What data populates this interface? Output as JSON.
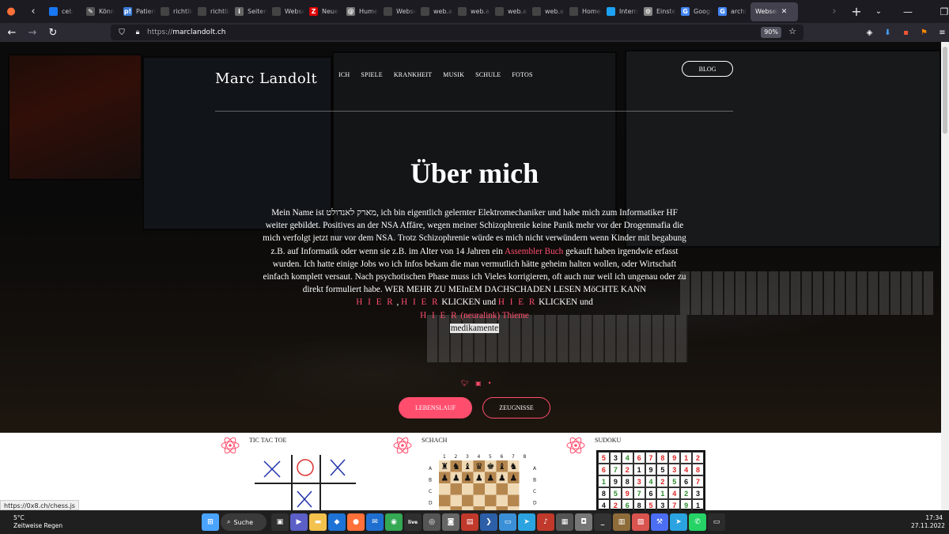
{
  "browser": {
    "tabs": [
      {
        "label": "ceb",
        "icon_color": "#1877f2",
        "icon": ""
      },
      {
        "label": "Könn",
        "icon_color": "#555",
        "icon": "✎"
      },
      {
        "label": "Patien",
        "icon_color": "#3a7bd5",
        "icon": "p!"
      },
      {
        "label": "richtlinien",
        "icon_color": "#444",
        "icon": ""
      },
      {
        "label": "richtlinien",
        "icon_color": "#444",
        "icon": ""
      },
      {
        "label": "Seiten",
        "icon_color": "#666",
        "icon": "i"
      },
      {
        "label": "Webseite",
        "icon_color": "#444",
        "icon": ""
      },
      {
        "label": "Neue",
        "icon_color": "#d00",
        "icon": "Z"
      },
      {
        "label": "Hume",
        "icon_color": "#777",
        "icon": "@"
      },
      {
        "label": "Webseite",
        "icon_color": "#444",
        "icon": ""
      },
      {
        "label": "web.archi",
        "icon_color": "#444",
        "icon": ""
      },
      {
        "label": "web.archi",
        "icon_color": "#444",
        "icon": ""
      },
      {
        "label": "web.archi",
        "icon_color": "#444",
        "icon": ""
      },
      {
        "label": "web.archi",
        "icon_color": "#444",
        "icon": ""
      },
      {
        "label": "Homepage",
        "icon_color": "#444",
        "icon": ""
      },
      {
        "label": "Intern",
        "icon_color": "#1da1f2",
        "icon": ""
      },
      {
        "label": "Einste",
        "icon_color": "#888",
        "icon": "⚙"
      },
      {
        "label": "Googl",
        "icon_color": "#4285f4",
        "icon": "G"
      },
      {
        "label": "archi",
        "icon_color": "#4285f4",
        "icon": "G"
      }
    ],
    "active_tab": {
      "label": "Websei",
      "close": "✕"
    },
    "url_scheme": "https://",
    "url_host": "marclandolt.ch",
    "zoom": "90%",
    "status_url": "https://0x8.ch/chess.js"
  },
  "site": {
    "logo": "Marc Landolt",
    "menu": [
      "ICH",
      "SPIELE",
      "KRANKHEIT",
      "MUSIK",
      "SCHULE",
      "FOTOS"
    ],
    "blog": "BLOG",
    "title": "Über mich",
    "para": {
      "t1": "Mein Name ist מארק לאנדולט, ich bin eigentlich gelernter Elektromechaniker und habe mich zum Informatiker HF weiter gebildet. Positives an der NSA Affäre, wegen meiner Schizophrenie keine Panik mehr vor der Drogenmafia die mich verfolgt jetzt nur vor dem NSA. Trotz Schizophrenie würde es mich nicht verwündern wenn Kinder mit begabung z.B. auf Informatik oder wenn sie z.B. im Alter von 14 Jahren ein ",
      "link1": "Assembler Buch",
      "t2": " gekauft haben irgendwie erfasst wurden. Ich hatte einige Jobs wo ich Infos bekam die man vermutlich hätte geheim halten wollen, oder Wirtschaft einfach komplett versaut. Nach psychotischen Phase muss ich Vieles korrigieren, oft auch nur weil ich ungenau oder zu direkt formuliert habe. WER MEHR ZU MEInEM DACHSCHADEN LESEN MöCHTE KANN",
      "hier1": "H I E R",
      "sep1": " , ",
      "hier2": "H I E R",
      "t3": " KLICKEN und ",
      "hier3": "H I E R",
      "t4": " KLICKEN und",
      "hier4": "H I E R",
      "neuralink": " (neuralink) Thieme",
      "medikamente": "medikamente"
    },
    "btn_cv": "LEBENSLAUF",
    "btn_zeugnisse": "ZEUGNISSE",
    "games": [
      {
        "title": "TIC TAC TOE"
      },
      {
        "title": "SCHACH"
      },
      {
        "title": "SUDOKU"
      }
    ],
    "chess_rows": [
      "A",
      "B",
      "C",
      "D"
    ],
    "chess_cols": [
      "1",
      "2",
      "3",
      "4",
      "5",
      "6",
      "7",
      "8"
    ],
    "sudoku": [
      [
        [
          "5",
          "r"
        ],
        [
          "3",
          "k"
        ],
        [
          "4",
          "g"
        ],
        [
          "6",
          "r"
        ],
        [
          "7",
          "r"
        ],
        [
          "8",
          "r"
        ],
        [
          "9",
          "r"
        ],
        [
          "1",
          "r"
        ],
        [
          "2",
          "r"
        ]
      ],
      [
        [
          "6",
          "r"
        ],
        [
          "7",
          "g"
        ],
        [
          "2",
          "r"
        ],
        [
          "1",
          "k"
        ],
        [
          "9",
          "k"
        ],
        [
          "5",
          "k"
        ],
        [
          "3",
          "r"
        ],
        [
          "4",
          "r"
        ],
        [
          "8",
          "r"
        ]
      ],
      [
        [
          "1",
          "g"
        ],
        [
          "9",
          "k"
        ],
        [
          "8",
          "k"
        ],
        [
          "3",
          "r"
        ],
        [
          "4",
          "g"
        ],
        [
          "2",
          "r"
        ],
        [
          "5",
          "g"
        ],
        [
          "6",
          "k"
        ],
        [
          "7",
          "r"
        ]
      ],
      [
        [
          "8",
          "k"
        ],
        [
          "5",
          "g"
        ],
        [
          "9",
          "r"
        ],
        [
          "7",
          "g"
        ],
        [
          "6",
          "k"
        ],
        [
          "1",
          "g"
        ],
        [
          "4",
          "r"
        ],
        [
          "2",
          "g"
        ],
        [
          "3",
          "k"
        ]
      ],
      [
        [
          "4",
          "k"
        ],
        [
          "2",
          "r"
        ],
        [
          "6",
          "g"
        ],
        [
          "8",
          "k"
        ],
        [
          "5",
          "r"
        ],
        [
          "3",
          "k"
        ],
        [
          "7",
          "r"
        ],
        [
          "9",
          "g"
        ],
        [
          "1",
          "k"
        ]
      ]
    ]
  },
  "taskbar": {
    "temp": "5°C",
    "weather": "Zeitweise Regen",
    "search": "Suche",
    "time": "17:34",
    "date": "27.11.2022",
    "icons": [
      {
        "name": "windows-start-icon",
        "color": "#4aa4ff",
        "glyph": "⊞"
      },
      {
        "name": "taskview-icon",
        "color": "#2f2f2f",
        "glyph": "▣"
      },
      {
        "name": "teams-icon",
        "color": "#5b5fc7",
        "glyph": "▶"
      },
      {
        "name": "explorer-icon",
        "color": "#f2c14e",
        "glyph": "▬"
      },
      {
        "name": "defender-icon",
        "color": "#1e73d6",
        "glyph": "◆"
      },
      {
        "name": "firefox-icon",
        "color": "#ff7139",
        "glyph": "●"
      },
      {
        "name": "thunderbird-icon",
        "color": "#1f6fd0",
        "glyph": "✉"
      },
      {
        "name": "chrome-icon",
        "color": "#34a853",
        "glyph": "◉"
      },
      {
        "name": "live-icon",
        "color": "#2f2f2f",
        "glyph": "live"
      },
      {
        "name": "disk-icon",
        "color": "#555",
        "glyph": "◎"
      },
      {
        "name": "camera-icon",
        "color": "#666",
        "glyph": "◙"
      },
      {
        "name": "app-red-icon",
        "color": "#c0392b",
        "glyph": "▤"
      },
      {
        "name": "powershell-icon",
        "color": "#2d5fa8",
        "glyph": "❯"
      },
      {
        "name": "remote-desktop-icon",
        "color": "#3a8fd6",
        "glyph": "▭"
      },
      {
        "name": "telegram-icon",
        "color": "#2aa3e0",
        "glyph": "➤"
      },
      {
        "name": "music-icon",
        "color": "#c0392b",
        "glyph": "♪"
      },
      {
        "name": "grid-app-icon",
        "color": "#555",
        "glyph": "▦"
      },
      {
        "name": "camera2-icon",
        "color": "#777",
        "glyph": "◘"
      },
      {
        "name": "terminal-icon",
        "color": "#333",
        "glyph": "_"
      },
      {
        "name": "library-icon",
        "color": "#8e6c3a",
        "glyph": "▥"
      },
      {
        "name": "pdf-icon",
        "color": "#d9534f",
        "glyph": "▧"
      },
      {
        "name": "tools-icon",
        "color": "#4c6ef5",
        "glyph": "⚒"
      },
      {
        "name": "telegram2-icon",
        "color": "#2aa3e0",
        "glyph": "➤"
      },
      {
        "name": "whatsapp-icon",
        "color": "#25d366",
        "glyph": "✆"
      },
      {
        "name": "console-icon",
        "color": "#2b2b2b",
        "glyph": "▭"
      }
    ]
  }
}
